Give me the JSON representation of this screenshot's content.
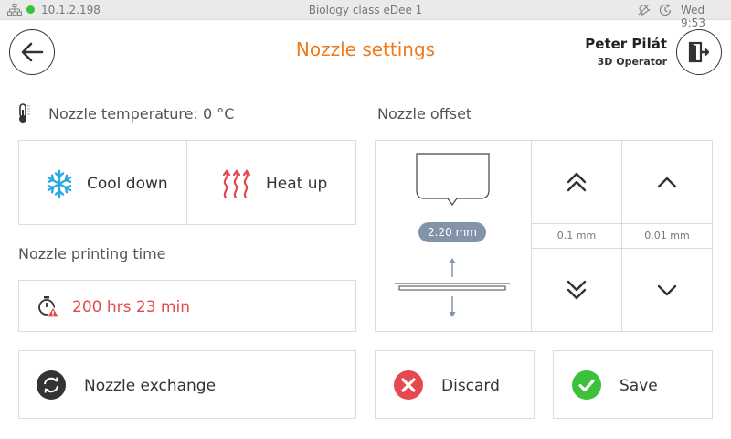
{
  "status_bar": {
    "ip": "10.1.2.198",
    "printer_name": "Biology class eDee 1",
    "time": "Wed 9:53"
  },
  "header": {
    "title": "Nozzle settings",
    "user_name": "Peter Pilát",
    "user_role": "3D Operator"
  },
  "temperature": {
    "label": "Nozzle temperature:",
    "value": "0 °C"
  },
  "actions": {
    "cool_down": "Cool down",
    "heat_up": "Heat up"
  },
  "printing_time": {
    "label": "Nozzle printing time",
    "value": "200 hrs 23 min"
  },
  "exchange": {
    "label": "Nozzle exchange"
  },
  "offset": {
    "label": "Nozzle offset",
    "value": "2.20 mm",
    "coarse_step": "0.1 mm",
    "fine_step": "0.01 mm"
  },
  "footer": {
    "discard": "Discard",
    "save": "Save"
  },
  "colors": {
    "accent": "#f07a1a",
    "warning_text": "#e5484d",
    "save_green": "#3cc13b",
    "discard_red": "#e5484d",
    "cool_blue": "#29a9e0"
  }
}
